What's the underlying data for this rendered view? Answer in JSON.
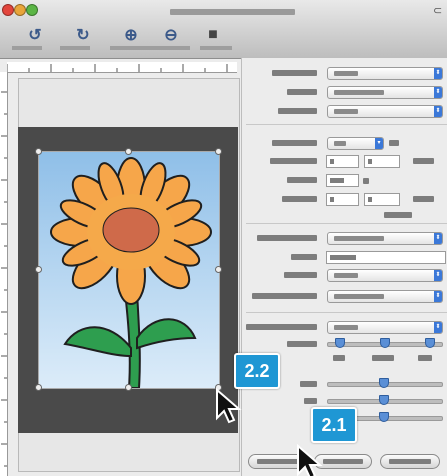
{
  "window": {
    "traffic_lights": [
      {
        "name": "close",
        "color": "#e2453c"
      },
      {
        "name": "minimize",
        "color": "#e8a53a"
      },
      {
        "name": "zoom",
        "color": "#5bb545"
      }
    ]
  },
  "toolbar": {
    "buttons": [
      {
        "icon": "rotate-left-icon",
        "glyph": "↺"
      },
      {
        "icon": "rotate-right-icon",
        "glyph": "↻"
      },
      {
        "icon": "zoom-in-icon",
        "glyph": "⊕"
      },
      {
        "icon": "zoom-out-icon",
        "glyph": "⊖"
      },
      {
        "icon": "overview-icon",
        "glyph": "■"
      }
    ]
  },
  "callouts": {
    "scan_area_label": "2.2",
    "scan_button_label": "2.1"
  },
  "colors": {
    "callout": "#1f97d4",
    "popup_arrow": "#3b78d8",
    "slider_thumb": "#5a8fd6"
  }
}
